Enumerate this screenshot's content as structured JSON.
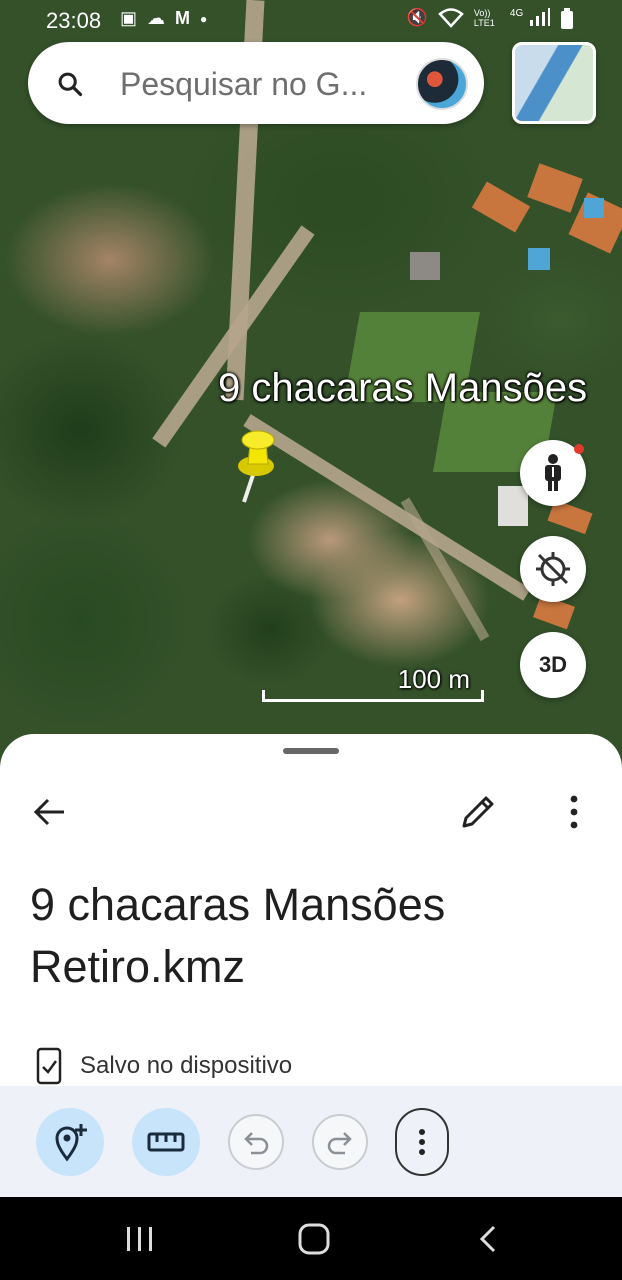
{
  "status_bar": {
    "time": "23:08",
    "left_icons": [
      "image-icon",
      "cloud-icon",
      "gmail-icon",
      "dot-icon"
    ],
    "right_icons": [
      "mute-icon",
      "wifi-icon",
      "volte-icon",
      "signal-icon",
      "battery-icon"
    ],
    "network_label": "Vo)) LTE1",
    "network_type": "4G"
  },
  "search": {
    "placeholder": "Pesquisar no G..."
  },
  "map": {
    "placemark_label": "9 chacaras Mansões",
    "scale_label": "100 m",
    "buttons": {
      "street_view": "pegman-icon",
      "location": "location-off-icon",
      "three_d": "3D"
    }
  },
  "sheet": {
    "title": "9 chacaras Mansões Retiro.kmz",
    "saved_label": "Salvo no dispositivo"
  },
  "toolbar": {
    "tools": [
      "add-placemark-icon",
      "ruler-icon",
      "undo-icon",
      "redo-icon",
      "more-vert-icon"
    ]
  },
  "navbar": {
    "buttons": [
      "recents-icon",
      "home-icon",
      "back-icon"
    ]
  },
  "colors": {
    "accent_light": "#c8e4fb",
    "toolbar_bg": "#eef2f8",
    "pin_yellow": "#f3e600"
  }
}
